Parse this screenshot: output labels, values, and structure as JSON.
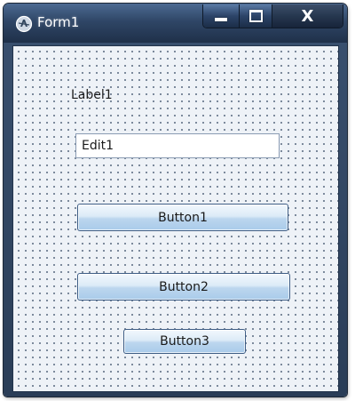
{
  "window": {
    "title": "Form1",
    "close_glyph": "X",
    "icons": {
      "app": "form-app-icon",
      "minimize": "minimize-icon",
      "maximize": "maximize-icon",
      "close": "close-icon"
    }
  },
  "form": {
    "label1": "Label1",
    "edit1_value": "Edit1",
    "button1": "Button1",
    "button2": "Button2",
    "button3": "Button3"
  },
  "colors": {
    "titlebar": "#2f4666",
    "client_background": "#eef2f7",
    "grid_dots": "#5f6f85",
    "button_face": "#dcebf7",
    "button_border": "#3f5e86"
  }
}
